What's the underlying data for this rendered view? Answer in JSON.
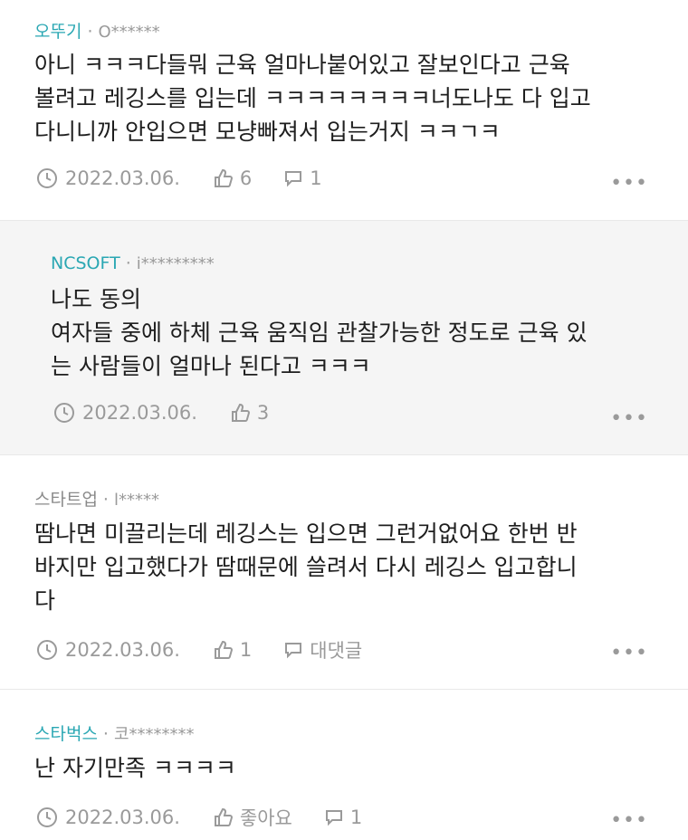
{
  "comments": [
    {
      "company": "오뚜기",
      "user": "O******",
      "text": "아니 ㅋㅋㅋ다들뭐 근육 얼마나붙어있고 잘보인다고 근육\n볼려고 레깅스를 입는데 ㅋㅋㅋㅋㅋㅋㅋㅋ너도나도 다 입고\n다니니까 안입으면 모냥빠져서 입는거지 ㅋㅋㄱㅋ",
      "date": "2022.03.06.",
      "likes": "6",
      "replies": "1"
    },
    {
      "company": "NCSOFT",
      "user": "i*********",
      "text": "나도 동의\n여자들 중에 하체 근육 움직임 관찰가능한 정도로 근육 있\n는 사람들이 얼마나 된다고 ㅋㅋㅋ",
      "date": "2022.03.06.",
      "likes": "3"
    },
    {
      "company": "스타트업",
      "user": "l*****",
      "text": "땀나면 미끌리는데 레깅스는 입으면 그런거없어요 한번 반\n바지만 입고했다가 땀때문에 쓸려서 다시 레깅스 입고합니\n다",
      "date": "2022.03.06.",
      "likes": "1",
      "replies": "대댓글"
    },
    {
      "company": "스타벅스",
      "user": "코********",
      "text": "난 자기만족 ㅋㅋㅋㅋ",
      "date": "2022.03.06.",
      "likes": "좋아요",
      "replies": "1"
    }
  ],
  "more_label": "•••",
  "colors": {
    "company": "#2aa7b3",
    "meta": "#9a9a9a",
    "reply_bg": "#f5f5f5"
  }
}
